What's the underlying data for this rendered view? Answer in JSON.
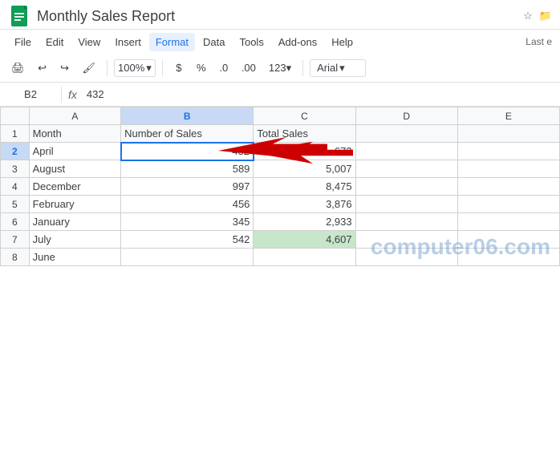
{
  "title": "Monthly Sales Report",
  "menu": {
    "items": [
      "File",
      "Edit",
      "View",
      "Insert",
      "Format",
      "Data",
      "Tools",
      "Add-ons",
      "Help"
    ]
  },
  "toolbar": {
    "zoom": "100%",
    "zoom_arrow": "▾",
    "currency": "$",
    "percent": "%",
    "decimal_less": ".0",
    "decimal_more": ".00",
    "format_num": "123",
    "font": "Arial",
    "font_arrow": "▾",
    "last_edit": "Last e"
  },
  "formula_bar": {
    "cell_ref": "B2",
    "fx": "fx",
    "value": "432"
  },
  "sheet": {
    "col_headers": [
      "",
      "A",
      "B",
      "C",
      "D",
      "E"
    ],
    "rows": [
      {
        "row_num": "1",
        "cells": [
          "Month",
          "Number of Sales",
          "Total Sales",
          "",
          ""
        ]
      },
      {
        "row_num": "2",
        "cells": [
          "April",
          "432",
          "672",
          "",
          ""
        ]
      },
      {
        "row_num": "3",
        "cells": [
          "August",
          "589",
          "5,007",
          "",
          ""
        ]
      },
      {
        "row_num": "4",
        "cells": [
          "December",
          "997",
          "8,475",
          "",
          ""
        ]
      },
      {
        "row_num": "5",
        "cells": [
          "February",
          "456",
          "3,876",
          "",
          ""
        ]
      },
      {
        "row_num": "6",
        "cells": [
          "January",
          "345",
          "2,933",
          "",
          ""
        ]
      },
      {
        "row_num": "7",
        "cells": [
          "July",
          "542",
          "4,607",
          "",
          ""
        ]
      },
      {
        "row_num": "8",
        "cells": [
          "June",
          "",
          "",
          "",
          ""
        ]
      }
    ]
  },
  "watermark": "computer06.com",
  "icons": {
    "print": "🖨",
    "undo": "↩",
    "redo": "↪",
    "paintformat": "🖌",
    "star": "☆",
    "folder": "📁",
    "chevron_down": "▾"
  }
}
